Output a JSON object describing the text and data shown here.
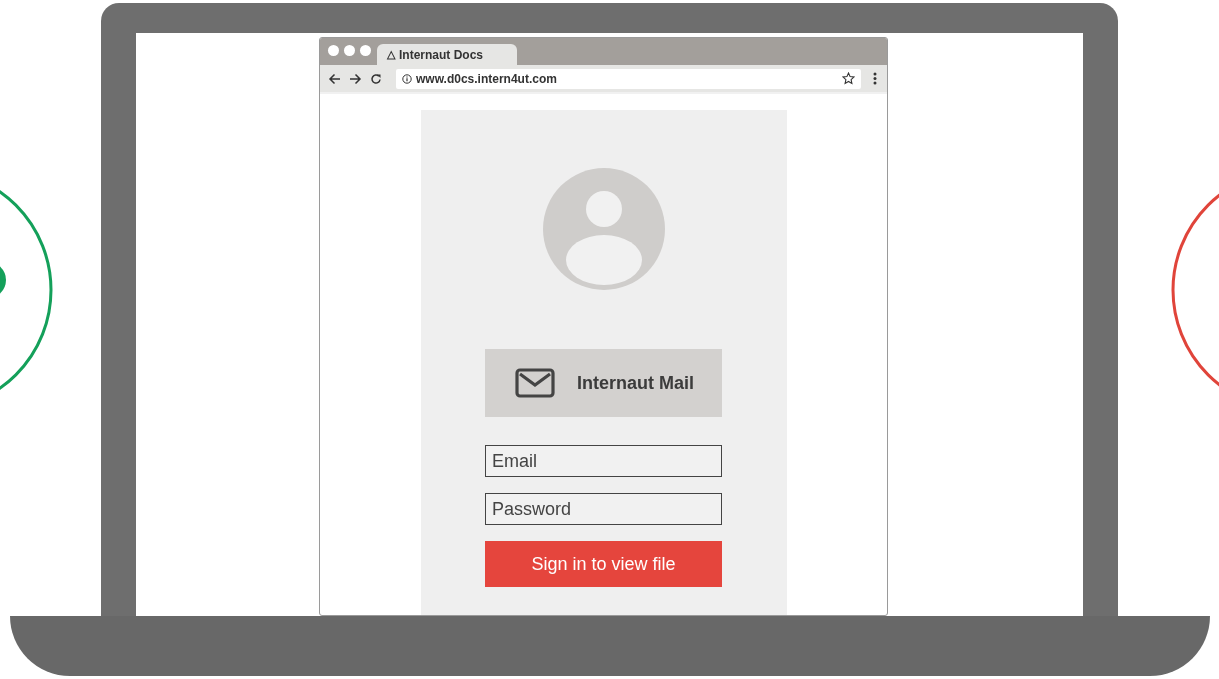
{
  "browser": {
    "tab": {
      "icon": "△",
      "title": "Internaut Docs"
    },
    "address": "www.d0cs.intern4ut.com"
  },
  "login": {
    "provider_button": "Internaut Mail",
    "fields": [
      {
        "placeholder": "Email"
      },
      {
        "placeholder": "Password"
      }
    ],
    "submit": "Sign in to view file"
  }
}
